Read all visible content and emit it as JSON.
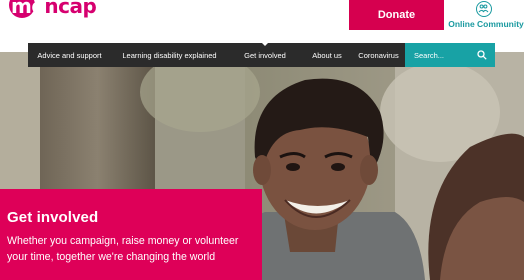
{
  "brand": {
    "logo_text": "mencap",
    "primary": "#d6006f",
    "accent": "#18a2a5",
    "nav_bg": "#2b2b2b"
  },
  "header": {
    "donate_label": "Donate",
    "community_label": "Online Community",
    "community_icon": "people-icon"
  },
  "nav": {
    "items": [
      {
        "label": "Advice and support"
      },
      {
        "label": "Learning disability explained"
      },
      {
        "label": "Get involved",
        "active": true
      },
      {
        "label": "About us"
      },
      {
        "label": "Coronavirus"
      }
    ],
    "search_placeholder": "Search..."
  },
  "hero": {
    "title": "Get involved",
    "text": "Whether you campaign, raise money or volunteer your time, together we're changing the world"
  }
}
